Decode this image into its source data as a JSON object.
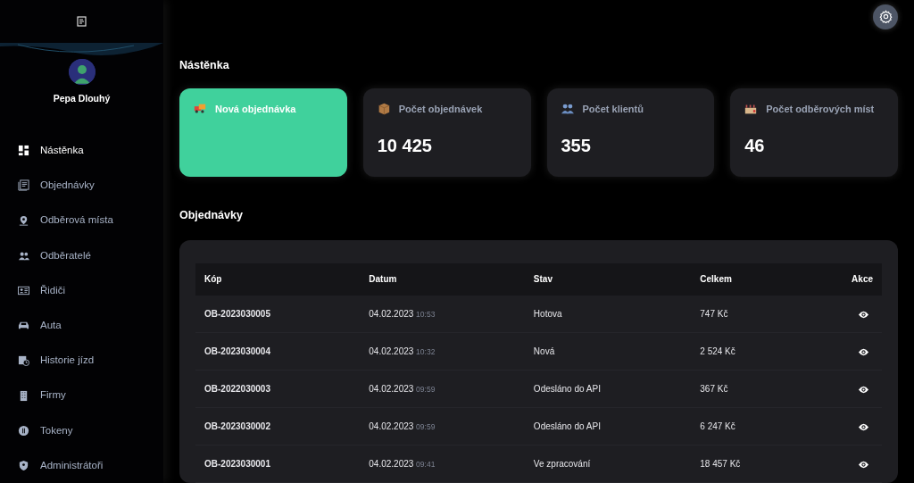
{
  "user": {
    "name": "Pepa Dlouhý"
  },
  "sidebar": {
    "items": [
      {
        "label": "Nástěnka",
        "selected": true
      },
      {
        "label": "Objednávky",
        "selected": false
      },
      {
        "label": "Odběrová místa",
        "selected": false
      },
      {
        "label": "Odběratelé",
        "selected": false
      },
      {
        "label": "Řidiči",
        "selected": false
      },
      {
        "label": "Auta",
        "selected": false
      },
      {
        "label": "Historie jízd",
        "selected": false
      },
      {
        "label": "Firmy",
        "selected": false
      },
      {
        "label": "Tokeny",
        "selected": false
      },
      {
        "label": "Administrátoři",
        "selected": false
      }
    ]
  },
  "page_title": "Nástěnka",
  "cards": [
    {
      "kind": "action",
      "label": "Nová objednávka"
    },
    {
      "kind": "stat",
      "label": "Počet objednávek",
      "value": "10 425"
    },
    {
      "kind": "stat",
      "label": "Počet klientů",
      "value": "355"
    },
    {
      "kind": "stat",
      "label": "Počet odběrových míst",
      "value": "46"
    }
  ],
  "orders": {
    "title": "Objednávky",
    "columns": [
      "Kóp",
      "Datum",
      "Stav",
      "Celkem",
      "Akce"
    ],
    "rows": [
      {
        "code": "OB-2023030005",
        "date": "04.02.2023",
        "time": "10:53",
        "status": "Hotova",
        "total": "747 Kč"
      },
      {
        "code": "OB-2023030004",
        "date": "04.02.2023",
        "time": "10:32",
        "status": "Nová",
        "total": "2 524 Kč"
      },
      {
        "code": "OB-2022030003",
        "date": "04.02.2023",
        "time": "09:59",
        "status": "Odesláno do API",
        "total": "367 Kč"
      },
      {
        "code": "OB-2023030002",
        "date": "04.02.2023",
        "time": "09:59",
        "status": "Odesláno do API",
        "total": "6 247 Kč"
      },
      {
        "code": "OB-2023030001",
        "date": "04.02.2023",
        "time": "09:41",
        "status": "Ve zpracování",
        "total": "18 457 Kč"
      }
    ]
  }
}
